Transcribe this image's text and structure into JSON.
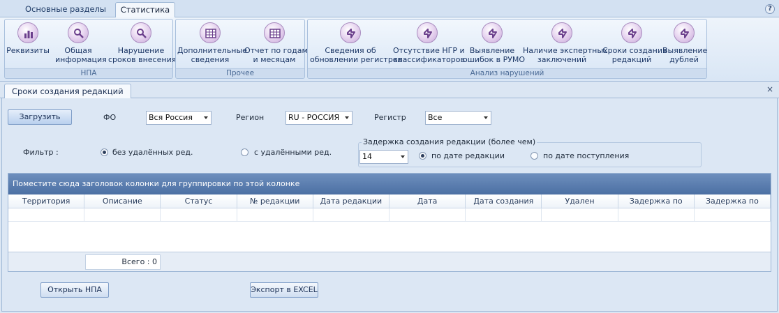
{
  "top_tabs": [
    {
      "label": "Основные разделы",
      "active": false
    },
    {
      "label": "Статистика",
      "active": true
    }
  ],
  "help_label": "?",
  "ribbon": {
    "groups": [
      {
        "label": "НПА",
        "buttons": [
          {
            "line1": "Реквизиты",
            "line2": "",
            "icon": "bar-chart-icon"
          },
          {
            "line1": "Общая",
            "line2": "информация",
            "icon": "magnifier-icon"
          },
          {
            "line1": "Нарушение",
            "line2": "сроков внесения",
            "icon": "magnifier-icon"
          }
        ]
      },
      {
        "label": "Прочее",
        "buttons": [
          {
            "line1": "Дополнительные",
            "line2": "сведения",
            "icon": "table-icon"
          },
          {
            "line1": "Отчет по годам",
            "line2": "и месяцам",
            "icon": "table-icon"
          }
        ]
      },
      {
        "label": "Анализ нарушений",
        "buttons": [
          {
            "line1": "Сведения об",
            "line2": "обновлении регистров",
            "icon": "lightning-icon"
          },
          {
            "line1": "Отсутствие НГР и",
            "line2": "классификаторов",
            "icon": "lightning-icon"
          },
          {
            "line1": "Выявление",
            "line2": "ошибок в РУМО",
            "icon": "lightning-icon"
          },
          {
            "line1": "Наличие экспертных",
            "line2": "заключений",
            "icon": "lightning-icon"
          },
          {
            "line1": "Сроки создания",
            "line2": "редакций",
            "icon": "lightning-icon"
          },
          {
            "line1": "Выявление",
            "line2": "дублей",
            "icon": "lightning-icon"
          }
        ]
      }
    ]
  },
  "document_tab": {
    "title": "Сроки создания редакций",
    "close_symbol": "×"
  },
  "form": {
    "load_button": "Загрузить",
    "fo_label": "ФО",
    "fo_value": "Вся Россия",
    "region_label": "Регион",
    "region_value": "RU - РОССИЯ",
    "register_label": "Регистр",
    "register_value": "Все",
    "filter_label": "Фильтр :",
    "filter_options": [
      {
        "label": "без удалённых ред.",
        "checked": true
      },
      {
        "label": "с удалёнными ред.",
        "checked": false
      }
    ],
    "delay_group_title": "Задержка создания редакции (более чем)",
    "delay_value": "14",
    "delay_options": [
      {
        "label": "по дате редакции",
        "checked": true
      },
      {
        "label": "по дате поступления",
        "checked": false
      }
    ]
  },
  "grid": {
    "group_hint": "Поместите сюда заголовок колонки для группировки по этой колонке",
    "columns": [
      "Территория",
      "Описание",
      "Статус",
      "№ редакции",
      "Дата редакции",
      "Дата",
      "Дата создания",
      "Удален",
      "Задержка по",
      "Задержка по"
    ],
    "total_label": "Всего : 0"
  },
  "bottom": {
    "open_button": "Открыть НПА",
    "export_button": "Экспорт в EXCEL"
  }
}
